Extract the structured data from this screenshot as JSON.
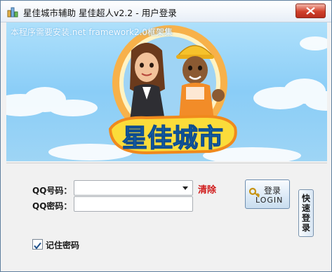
{
  "window": {
    "title": "星佳城市辅助 星佳超人v2.2 - 用户登录",
    "icon": "app-icon"
  },
  "banner": {
    "framework_note": "本程序需要安装.net framework2.0框架集",
    "logo_text": "星佳城市"
  },
  "login": {
    "qq_label": "QQ号码：",
    "qq_value": "",
    "password_label": "QQ密码：",
    "password_value": "",
    "clear_label": "清除",
    "login_button_cn": "登录",
    "login_button_en": "LOGIN",
    "quick_login_label": "快速登录",
    "remember_label": "记住密码",
    "remember_checked": true
  },
  "colors": {
    "clear_link": "#d01a1a",
    "sky": "#8acdf7",
    "logo_orange": "#f0891d"
  }
}
